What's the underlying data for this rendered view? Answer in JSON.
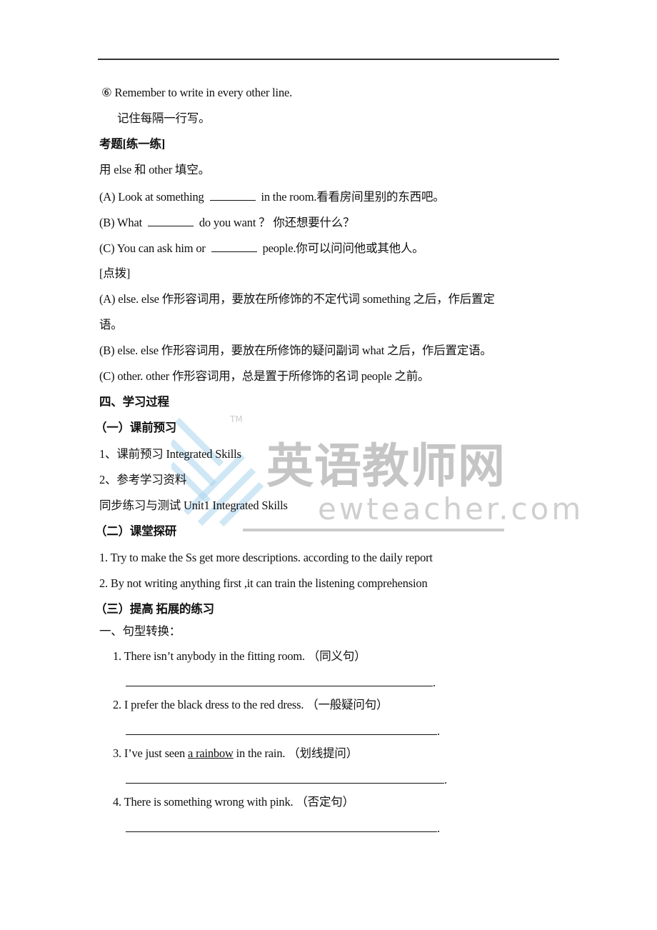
{
  "document": {
    "lines": [
      {
        "id": "tip6",
        "text": "⑥ Remember to write in every other line."
      },
      {
        "id": "tip6_cn",
        "text": "记住每隔一行写。"
      },
      {
        "id": "exam_heading",
        "text": "考题[练一练]"
      },
      {
        "id": "instruction",
        "text": "用 else  和 other 填空。"
      },
      {
        "id": "qA",
        "before": "(A) Look at something",
        "after": "in the room.看看房间里别的东西吧。"
      },
      {
        "id": "qB",
        "before": "(B) What",
        "after": "do you want  ？  你还想要什么？"
      },
      {
        "id": "qC",
        "before": "(C) You can ask him or",
        "after": "people.你可以问问他或其他人。"
      },
      {
        "id": "hint_heading",
        "text": "[点拨]"
      },
      {
        "id": "hintA",
        "text": "(A) else. else  作形容词用，要放在所修饰的不定代词 something 之后，作后置定"
      },
      {
        "id": "hintA_cont",
        "text": "语。"
      },
      {
        "id": "hintB",
        "text": "(B) else. else  作形容词用，要放在所修饰的疑问副词 what 之后，作后置定语。"
      },
      {
        "id": "hintC",
        "text": "(C) other. other  作形容词用，总是置于所修饰的名词 people 之前。"
      },
      {
        "id": "sec4",
        "text": "四、学习过程"
      },
      {
        "id": "sub1",
        "text": "（一）课前预习"
      },
      {
        "id": "item1",
        "text": "1、课前预习 Integrated Skills"
      },
      {
        "id": "item2",
        "text": "2、参考学习资料"
      },
      {
        "id": "item3",
        "text": "同步练习与测试  Unit1 Integrated Skills"
      },
      {
        "id": "sub2",
        "text": "（二）课堂探研"
      },
      {
        "id": "explore1",
        "text": "1. Try to make the Ss get more descriptions. according to the daily report"
      },
      {
        "id": "explore2",
        "text": "2. By not writing anything first ,it can train the listening comprehension"
      },
      {
        "id": "sub3",
        "text": "（三）提高  拓展的练习"
      },
      {
        "id": "part1",
        "text": "一、句型转换："
      }
    ],
    "exercises": [
      {
        "num": "1.",
        "sentence": "There isn’t anybody in the fitting room.",
        "hint": "（同义句）"
      },
      {
        "num": "2.",
        "sentence": "I prefer the black dress to the red dress.",
        "hint": "（一般疑问句）"
      },
      {
        "num": "3.",
        "pre": "I’ve just seen ",
        "underlined": "a rainbow",
        "post": " in the rain.",
        "hint": "（划线提问）"
      },
      {
        "num": "4.",
        "sentence": "There is something wrong with pink.",
        "hint": "（否定句）"
      }
    ],
    "answer_terminator": "."
  },
  "watermark": {
    "chinese": "英语教师网",
    "english": "ewteacher.com",
    "tm": "TM",
    "logo_color": "#9ecbe6"
  }
}
